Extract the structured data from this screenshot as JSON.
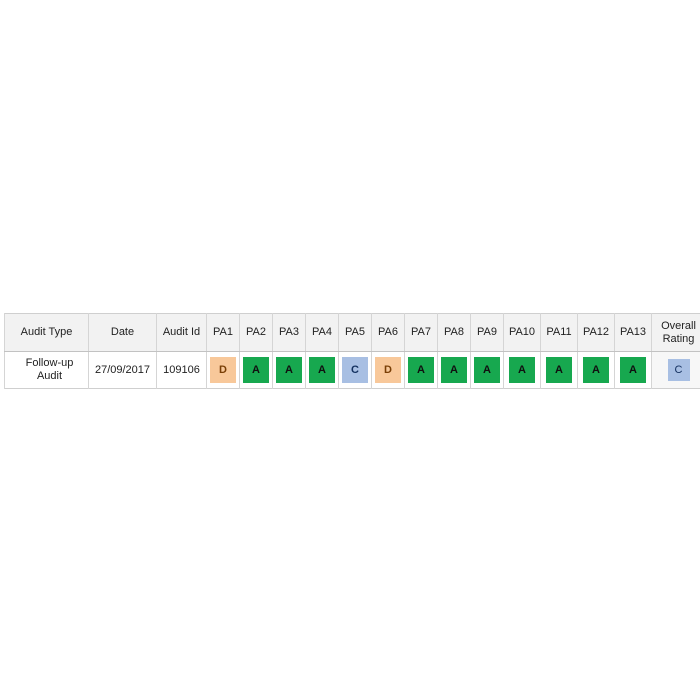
{
  "table": {
    "columns": [
      {
        "key": "audit_type",
        "label": "Audit Type"
      },
      {
        "key": "date",
        "label": "Date"
      },
      {
        "key": "audit_id",
        "label": "Audit Id"
      },
      {
        "key": "pa1",
        "label": "PA1"
      },
      {
        "key": "pa2",
        "label": "PA2"
      },
      {
        "key": "pa3",
        "label": "PA3"
      },
      {
        "key": "pa4",
        "label": "PA4"
      },
      {
        "key": "pa5",
        "label": "PA5"
      },
      {
        "key": "pa6",
        "label": "PA6"
      },
      {
        "key": "pa7",
        "label": "PA7"
      },
      {
        "key": "pa8",
        "label": "PA8"
      },
      {
        "key": "pa9",
        "label": "PA9"
      },
      {
        "key": "pa10",
        "label": "PA10"
      },
      {
        "key": "pa11",
        "label": "PA11"
      },
      {
        "key": "pa12",
        "label": "PA12"
      },
      {
        "key": "pa13",
        "label": "PA13"
      },
      {
        "key": "overall",
        "label_line1": "Overall",
        "label_line2": "Rating"
      }
    ],
    "row": {
      "audit_type_line1": "Follow-up",
      "audit_type_line2": "Audit",
      "date": "27/09/2017",
      "audit_id": "109106",
      "pa1": "D",
      "pa2": "A",
      "pa3": "A",
      "pa4": "A",
      "pa5": "C",
      "pa6": "D",
      "pa7": "A",
      "pa8": "A",
      "pa9": "A",
      "pa10": "A",
      "pa11": "A",
      "pa12": "A",
      "pa13": "A",
      "overall": "C"
    }
  },
  "colors": {
    "rating_a": "#17a84f",
    "rating_c": "#a8bfe3",
    "rating_d": "#f8c89a",
    "header_background": "#f2f2f2",
    "border": "#d5d5d5"
  }
}
